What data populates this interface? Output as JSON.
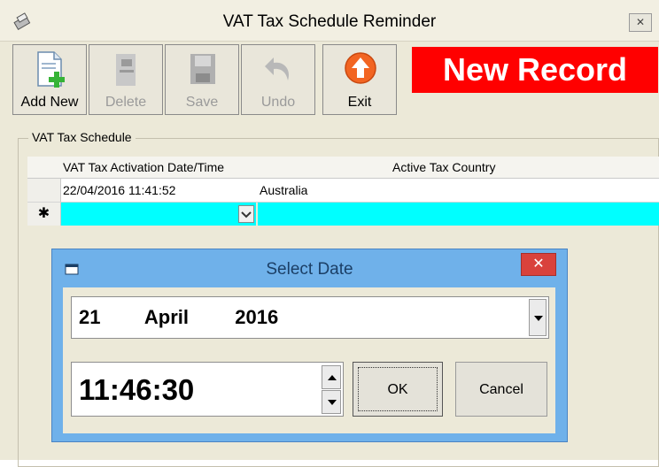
{
  "window": {
    "title": "VAT Tax Schedule Reminder",
    "close_glyph": "✕"
  },
  "toolbar": {
    "buttons": [
      {
        "label": "Add New",
        "icon": "add-document-icon",
        "enabled": true
      },
      {
        "label": "Delete",
        "icon": "delete-icon",
        "enabled": false
      },
      {
        "label": "Save",
        "icon": "save-icon",
        "enabled": false
      },
      {
        "label": "Undo",
        "icon": "undo-icon",
        "enabled": false
      },
      {
        "label": "Exit",
        "icon": "exit-icon",
        "enabled": true
      }
    ]
  },
  "status_banner": {
    "text": "New Record",
    "background": "#ff0000",
    "color": "#ffffff"
  },
  "group": {
    "title": "VAT Tax Schedule"
  },
  "grid": {
    "columns": [
      "VAT Tax Activation Date/Time",
      "Active Tax Country"
    ],
    "rows": [
      {
        "date": "22/04/2016 11:41:52",
        "country": "Australia"
      }
    ],
    "new_row_marker": "✱",
    "new_row_color": "#00ffff"
  },
  "dialog": {
    "title": "Select Date",
    "close_glyph": "✕",
    "date": {
      "day": "21",
      "month": "April",
      "year": "2016"
    },
    "time": "11:46:30",
    "ok_label": "OK",
    "cancel_label": "Cancel",
    "accent": "#6fb1ea"
  }
}
